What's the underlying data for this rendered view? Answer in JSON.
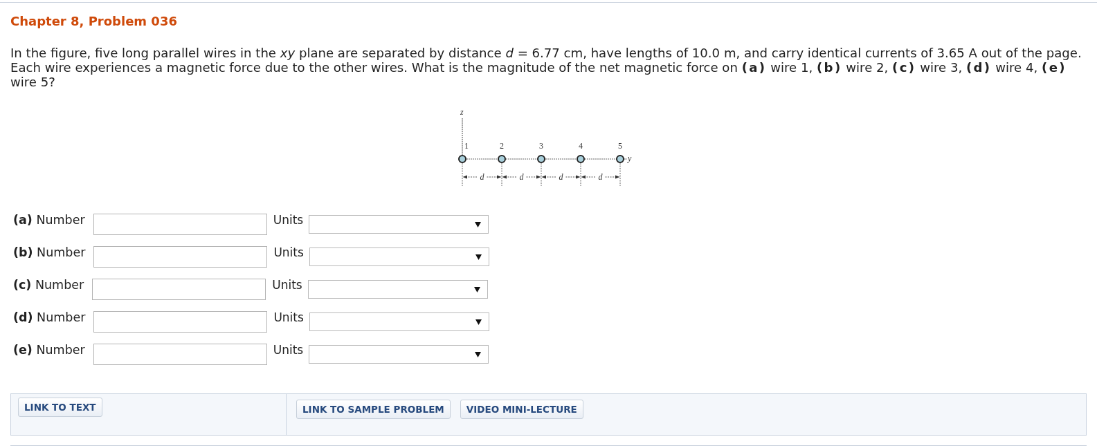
{
  "title": "Chapter 8, Problem 036",
  "problem": "In the figure, five long parallel wires in the *xy* plane are separated by distance *d* = 6.77 cm, have lengths of 10.0 m, and carry identical currents of 3.65 A out of the page. Each wire experiences a magnetic force due to the other wires. What is the magnitude of the net magnetic force on **(a)** wire 1, **(b)** wire 2, **(c)** wire 3, **(d)** wire 4, **(e)** wire 5?",
  "figure": {
    "vertical_axis_label": "z",
    "horizontal_axis_label": "y",
    "wires": [
      "1",
      "2",
      "3",
      "4",
      "5"
    ],
    "spacings": [
      "d",
      "d",
      "d",
      "d"
    ]
  },
  "answers": [
    {
      "label": "**(a)** Number",
      "units_label": "Units"
    },
    {
      "label": "**(b)** Number",
      "units_label": "Units"
    },
    {
      "label": "**(c)** Number",
      "units_label": "Units"
    },
    {
      "label": "**(d)** Number",
      "units_label": "Units"
    },
    {
      "label": "**(e)** Number",
      "units_label": "Units"
    }
  ],
  "resources": {
    "text_links": [
      "LINK TO TEXT"
    ],
    "extra_links": [
      "LINK TO SAMPLE PROBLEM",
      "VIDEO MINI-LECTURE"
    ]
  }
}
